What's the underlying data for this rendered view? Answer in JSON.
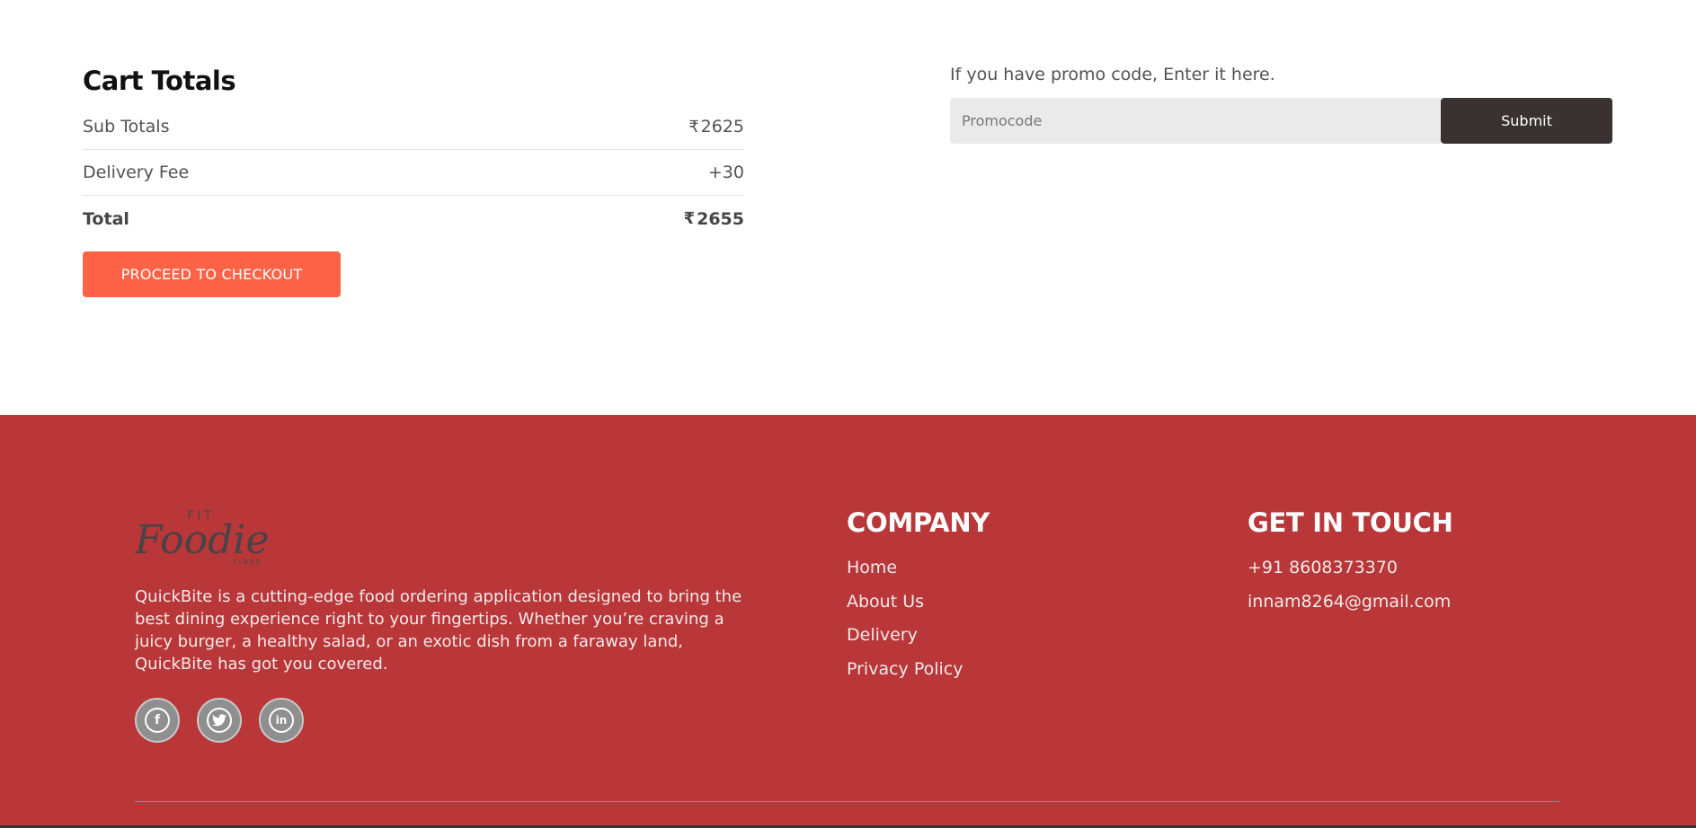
{
  "cart": {
    "title": "Cart Totals",
    "rows": [
      {
        "label": "Sub Totals",
        "currency": "₹",
        "value": "2625"
      },
      {
        "label": "Delivery Fee",
        "currency": "",
        "value": "+30"
      },
      {
        "label": "Total",
        "currency": "₹",
        "value": "2655"
      }
    ],
    "checkout_label": "PROCEED TO CHECKOUT"
  },
  "promo": {
    "label": "If you have promo code, Enter it here.",
    "placeholder": "Promocode",
    "value": "",
    "submit_label": "Submit"
  },
  "footer": {
    "logo": {
      "icon": "foodie-finds-logo",
      "text_top": "FIT",
      "text_main": "Foodie",
      "text_bottom": "FINDS"
    },
    "about": "QuickBite is a cutting-edge food ordering application designed to bring the best dining experience right to your fingertips. Whether you’re craving a juicy burger, a healthy salad, or an exotic dish from a faraway land, QuickBite has got you covered.",
    "socials": [
      {
        "icon": "facebook-icon",
        "glyph": "f"
      },
      {
        "icon": "twitter-icon",
        "glyph": ""
      },
      {
        "icon": "linkedin-icon",
        "glyph": "in"
      }
    ],
    "company": {
      "title": "COMPANY",
      "links": [
        "Home",
        "About Us",
        "Delivery",
        "Privacy Policy"
      ]
    },
    "contact": {
      "title": "GET IN TOUCH",
      "phone": "+91 8608373370",
      "email": "innam8264@gmail.com"
    }
  },
  "colors": {
    "accent": "#ff6347",
    "footer_bg": "#b93738",
    "dark_button": "#3a3232",
    "input_bg": "#eaeaea"
  }
}
